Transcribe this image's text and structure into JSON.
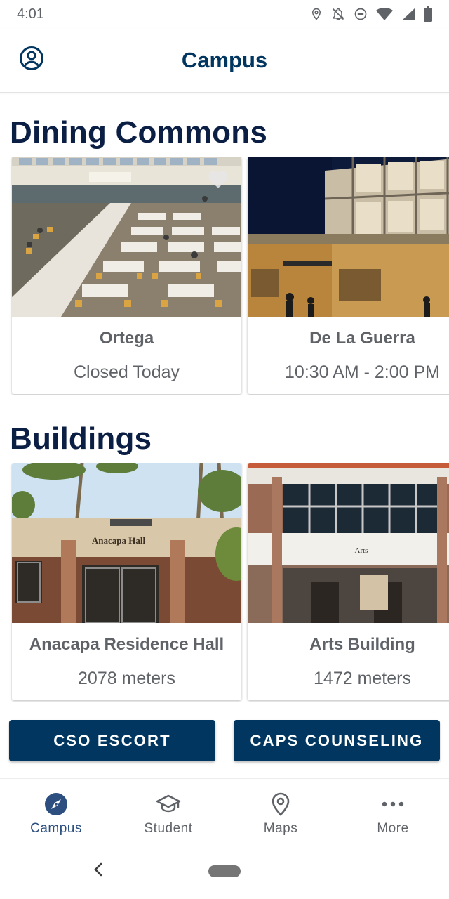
{
  "status_bar": {
    "time": "4:01",
    "icons": [
      "location-icon",
      "notifications-off-icon",
      "do-not-disturb-icon",
      "wifi-icon",
      "signal-icon",
      "battery-icon"
    ]
  },
  "app_bar": {
    "title": "Campus",
    "profile_icon": "account-circle-icon"
  },
  "dining": {
    "title": "Dining Commons",
    "cards": [
      {
        "title": "Ortega",
        "subtitle": "Closed Today",
        "favorite_icon": "heart-icon"
      },
      {
        "title": "De La Guerra",
        "subtitle": "10:30 AM - 2:00 PM",
        "favorite_icon": "heart-icon"
      }
    ]
  },
  "buildings": {
    "title": "Buildings",
    "cards": [
      {
        "title": "Anacapa Residence Hall",
        "subtitle": "2078 meters",
        "sign_text": "Anacapa Hall"
      },
      {
        "title": "Arts Building",
        "subtitle": "1472 meters",
        "sign_text": "Arts"
      }
    ]
  },
  "actions": {
    "cso_escort": "CSO ESCORT",
    "caps_counseling": "CAPS COUNSELING"
  },
  "bottom_nav": {
    "items": [
      {
        "label": "Campus",
        "icon": "compass-icon",
        "active": true
      },
      {
        "label": "Student",
        "icon": "graduation-cap-icon",
        "active": false
      },
      {
        "label": "Maps",
        "icon": "map-pin-icon",
        "active": false
      },
      {
        "label": "More",
        "icon": "more-horiz-icon",
        "active": false
      }
    ]
  },
  "colors": {
    "primary": "#003660",
    "heading": "#0b1f44",
    "nav_active": "#2d4f7f",
    "muted_text": "#5f6368"
  }
}
